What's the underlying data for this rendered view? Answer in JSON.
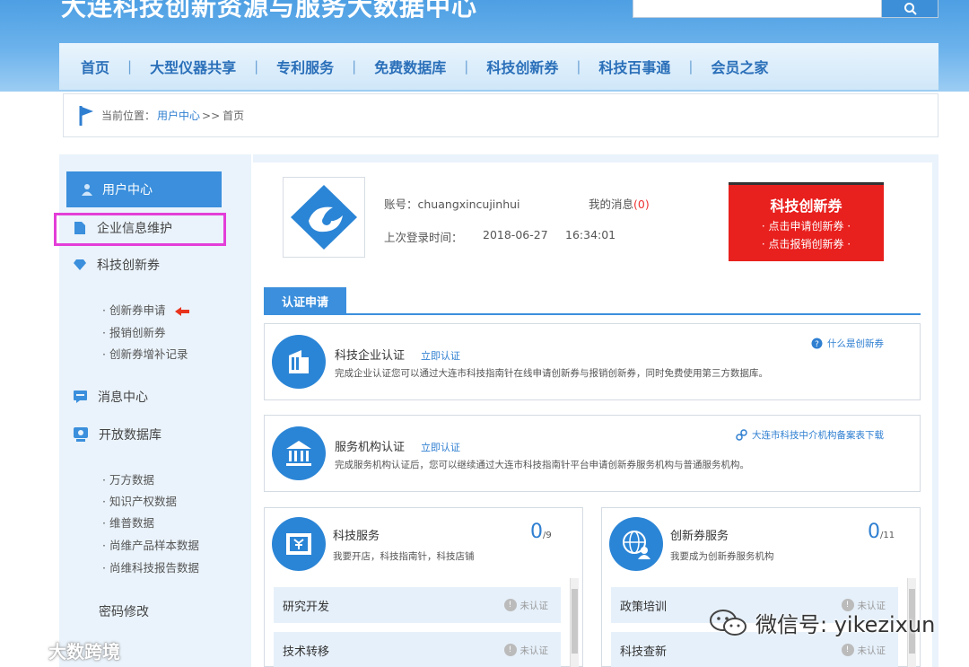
{
  "header": {
    "site_title": "大连科技创新资源与服务大数据中心"
  },
  "nav": {
    "items": [
      "首页",
      "大型仪器共享",
      "专利服务",
      "免费数据库",
      "科技创新券",
      "科技百事通",
      "会员之家"
    ]
  },
  "breadcrumb": {
    "label": "当前位置：",
    "link": "用户中心",
    "separator": ">>",
    "current": "首页"
  },
  "sidebar": {
    "active": "用户中心",
    "item_company": "企业信息维护",
    "item_voucher": "科技创新券",
    "voucher_subs": [
      "· 创新券申请",
      "· 报销创新券",
      "· 创新券增补记录"
    ],
    "item_messages": "消息中心",
    "item_database": "开放数据库",
    "database_subs": [
      "· 万方数据",
      "· 知识产权数据",
      "· 维普数据",
      "· 尚维产品样本数据",
      "· 尚维科技报告数据"
    ],
    "item_password": "密码修改"
  },
  "profile": {
    "account_label": "账号：",
    "account": "chuangxincujinhui",
    "messages_label": "我的消息",
    "messages_count": "(0)",
    "last_login_label": "上次登录时间：",
    "last_login_date": "2018-06-27",
    "last_login_time": "16:34:01"
  },
  "voucher_banner": {
    "title": "科技创新券",
    "apply": "· 点击申请创新券 ·",
    "reimburse": "· 点击报销创新券 ·"
  },
  "certification": {
    "tab": "认证申请",
    "company": {
      "title": "科技企业认证",
      "link": "立即认证",
      "desc": "完成企业认证您可以通过大连市科技指南针在线申请创新券与报销创新券，同时免费使用第三方数据库。",
      "right_link": "什么是创新券"
    },
    "agency": {
      "title": "服务机构认证",
      "link": "立即认证",
      "desc": "完成服务机构认证后，您可以继续通过大连市科技指南针平台申请创新券服务机构与普通服务机构。",
      "right_link": "大连市科技中介机构备案表下载"
    }
  },
  "services": {
    "tech": {
      "title": "科技服务",
      "desc": "我要开店，科技指南针，科技店铺",
      "count": "0",
      "total": "/9",
      "rows": [
        {
          "label": "研究开发",
          "status": "未认证"
        },
        {
          "label": "技术转移",
          "status": "未认证"
        }
      ]
    },
    "voucher": {
      "title": "创新券服务",
      "desc": "我要成为创新券服务机构",
      "count": "0",
      "total": "/11",
      "rows": [
        {
          "label": "政策培训",
          "status": "未认证"
        },
        {
          "label": "科技查新",
          "status": "未认证"
        }
      ]
    }
  },
  "watermarks": {
    "left": "大数跨境",
    "right": "微信号: yikezixun"
  },
  "colors": {
    "primary": "#3b8fdc",
    "voucher_red": "#e8201e",
    "highlight": "#e33ed8"
  }
}
